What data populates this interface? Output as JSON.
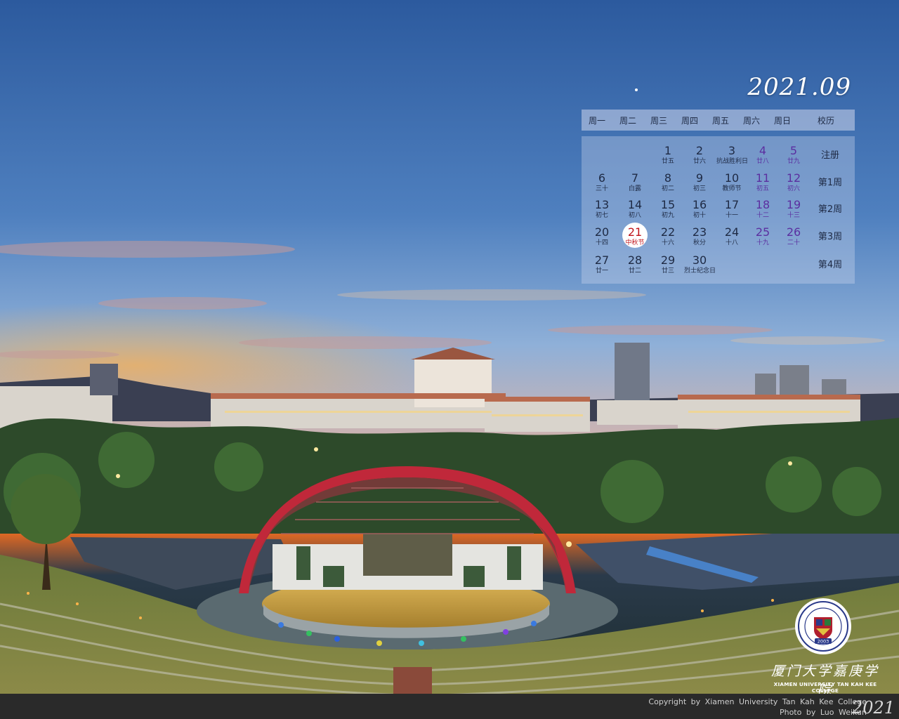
{
  "calendar": {
    "title": "2021.09",
    "headers": [
      "周一",
      "周二",
      "周三",
      "周四",
      "周五",
      "周六",
      "周日",
      "校历"
    ],
    "rows": [
      {
        "week": "注册",
        "days": [
          null,
          null,
          {
            "d": "1",
            "l": "廿五"
          },
          {
            "d": "2",
            "l": "廿六"
          },
          {
            "d": "3",
            "l": "抗战胜利日"
          },
          {
            "d": "4",
            "l": "廿八"
          },
          {
            "d": "5",
            "l": "廿九"
          }
        ]
      },
      {
        "week": "第1周",
        "days": [
          {
            "d": "6",
            "l": "三十"
          },
          {
            "d": "7",
            "l": "白露"
          },
          {
            "d": "8",
            "l": "初二"
          },
          {
            "d": "9",
            "l": "初三"
          },
          {
            "d": "10",
            "l": "教师节"
          },
          {
            "d": "11",
            "l": "初五"
          },
          {
            "d": "12",
            "l": "初六"
          }
        ]
      },
      {
        "week": "第2周",
        "days": [
          {
            "d": "13",
            "l": "初七"
          },
          {
            "d": "14",
            "l": "初八"
          },
          {
            "d": "15",
            "l": "初九"
          },
          {
            "d": "16",
            "l": "初十"
          },
          {
            "d": "17",
            "l": "十一"
          },
          {
            "d": "18",
            "l": "十二"
          },
          {
            "d": "19",
            "l": "十三"
          }
        ]
      },
      {
        "week": "第3周",
        "days": [
          {
            "d": "20",
            "l": "十四"
          },
          {
            "d": "21",
            "l": "中秋节",
            "highlight": true
          },
          {
            "d": "22",
            "l": "十六"
          },
          {
            "d": "23",
            "l": "秋分"
          },
          {
            "d": "24",
            "l": "十八"
          },
          {
            "d": "25",
            "l": "十九"
          },
          {
            "d": "26",
            "l": "二十"
          }
        ]
      },
      {
        "week": "第4周",
        "days": [
          {
            "d": "27",
            "l": "廿一"
          },
          {
            "d": "28",
            "l": "廿二"
          },
          {
            "d": "29",
            "l": "廿三"
          },
          {
            "d": "30",
            "l": "烈士纪念日"
          },
          null,
          null,
          null
        ]
      }
    ]
  },
  "logo": {
    "name_cn": "厦门大学嘉庚学院",
    "name_en": "XIAMEN UNIVERSITY TAN KAH KEE COLLEGE",
    "emblem_year": "2003"
  },
  "footer": {
    "copyright": "Copyright by Xiamen University Tan Kah Kee College",
    "photo": "Photo by Luo Weikun",
    "year": "2021"
  },
  "colors": {
    "weekend": "#5b2fa0",
    "holiday": "#c0141b",
    "sky_top": "#2f5da3",
    "sunset": "#f08a2a"
  },
  "icons": [
    "school-emblem-icon"
  ]
}
